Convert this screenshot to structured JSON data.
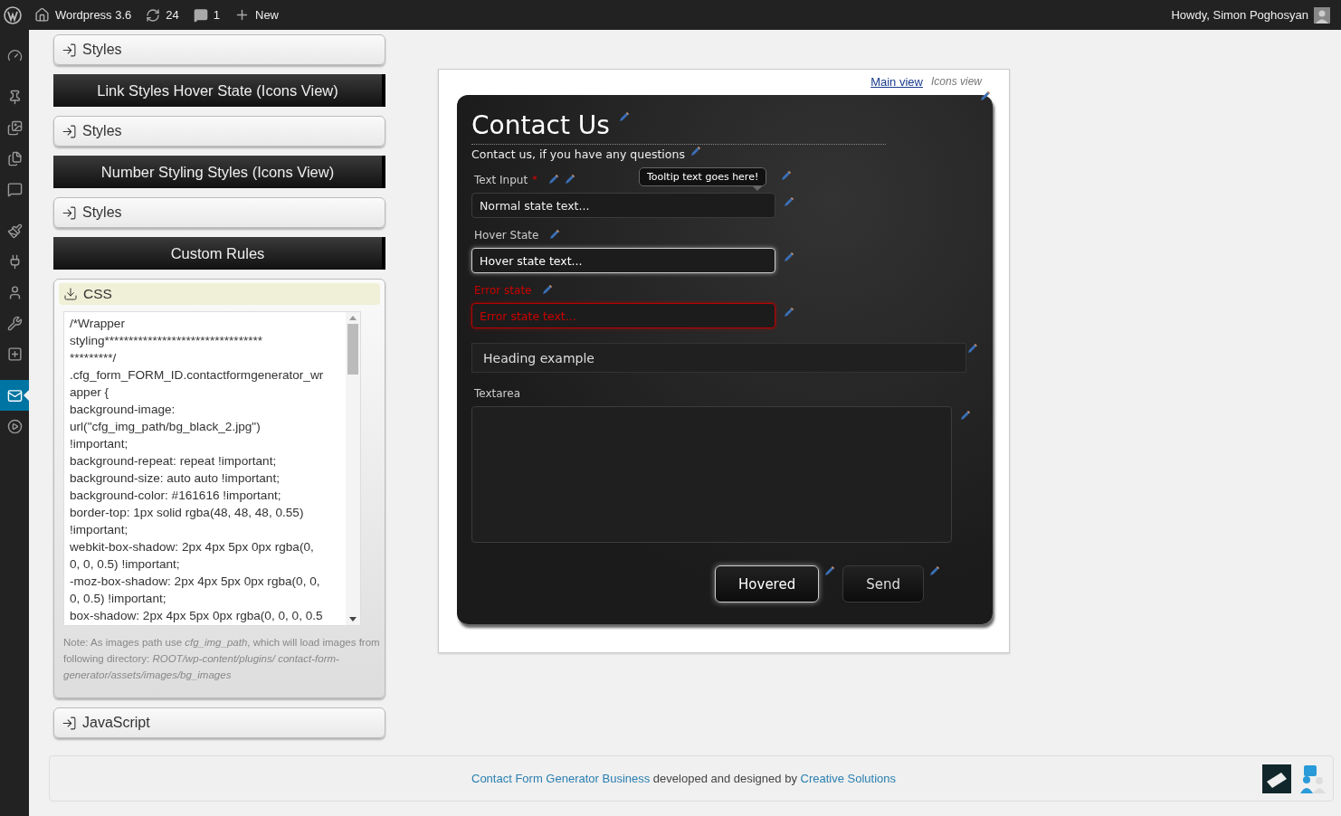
{
  "admin_bar": {
    "site": "Wordpress 3.6",
    "updates": "24",
    "comments": "1",
    "new": "New",
    "greeting": "Howdy, Simon Poghosyan"
  },
  "sidebar": {
    "groups": [
      {
        "items": [
          {
            "selected": false
          }
        ]
      },
      {
        "items": [
          {
            "selected": false
          },
          {
            "selected": false
          },
          {
            "selected": false
          },
          {
            "selected": false
          }
        ]
      },
      {
        "items": [
          {
            "selected": false
          },
          {
            "selected": false
          },
          {
            "selected": false
          },
          {
            "selected": false
          },
          {
            "selected": false
          }
        ]
      },
      {
        "items": [
          {
            "selected": true
          },
          {
            "selected": false
          }
        ]
      }
    ]
  },
  "panels": [
    {
      "kind": "collapsed",
      "label": "Styles"
    },
    {
      "kind": "header",
      "label": "Link Styles Hover State (Icons View)"
    },
    {
      "kind": "collapsed",
      "label": "Styles"
    },
    {
      "kind": "header",
      "label": "Number Styling Styles (Icons View)"
    },
    {
      "kind": "collapsed",
      "label": "Styles"
    },
    {
      "kind": "header",
      "label": "Custom Rules"
    },
    {
      "kind": "expanded",
      "label": "CSS",
      "code_lines": [
        "/*Wrapper",
        "styling*********************************",
        "*********/",
        ".cfg_form_FORM_ID.contactformgenerator_wr",
        "apper {",
        "background-image:",
        "url(\"cfg_img_path/bg_black_2.jpg\")",
        "!important;",
        "background-repeat: repeat !important;",
        "background-size: auto auto !important;",
        "background-color: #161616 !important;",
        "border-top: 1px solid rgba(48, 48, 48, 0.55)",
        "!important;",
        "webkit-box-shadow: 2px 4px 5px 0px rgba(0,",
        "0, 0, 0.5) !important;",
        "-moz-box-shadow: 2px 4px 5px 0px rgba(0, 0,",
        "0, 0.5) !important;",
        "box-shadow: 2px 4px 5px 0px rgba(0, 0, 0, 0.5"
      ],
      "note": "Note: As images path use *cfg_img_path*, which will load images from following directory: *ROOT/wp-content/plugins/ contact-form-generator/assets/images/bg_images*"
    },
    {
      "kind": "collapsed",
      "label": "JavaScript"
    }
  ],
  "preview": {
    "views": [
      {
        "label": "Main view",
        "selected": true
      },
      {
        "label": "Icons view",
        "selected": false
      }
    ],
    "form": {
      "title": "Contact Us",
      "subtitle": "Contact us, if you have any questions",
      "fields": [
        {
          "kind": "input",
          "label": "Text Input",
          "required_mark": "*",
          "placeholder": "Normal state text...",
          "hovered": false,
          "error": false,
          "tooltip": "Tooltip text goes here!"
        },
        {
          "kind": "input",
          "label": "Hover State",
          "placeholder": "Hover state text...",
          "hovered": true,
          "error": false
        },
        {
          "kind": "input",
          "label": "Error state",
          "placeholder": "Error state text...",
          "hovered": false,
          "error": true
        },
        {
          "kind": "heading",
          "label": "Heading example"
        },
        {
          "kind": "textarea",
          "label": "Textarea"
        }
      ],
      "buttons": [
        {
          "label": "Hovered",
          "hovered": true
        },
        {
          "label": "Send",
          "hovered": false
        }
      ]
    }
  },
  "footer": {
    "parts": [
      {
        "kind": "link",
        "text": "Contact Form Generator Business"
      },
      {
        "kind": "text",
        "text": " developed and designed by "
      },
      {
        "kind": "link",
        "text": "Creative Solutions"
      }
    ]
  }
}
